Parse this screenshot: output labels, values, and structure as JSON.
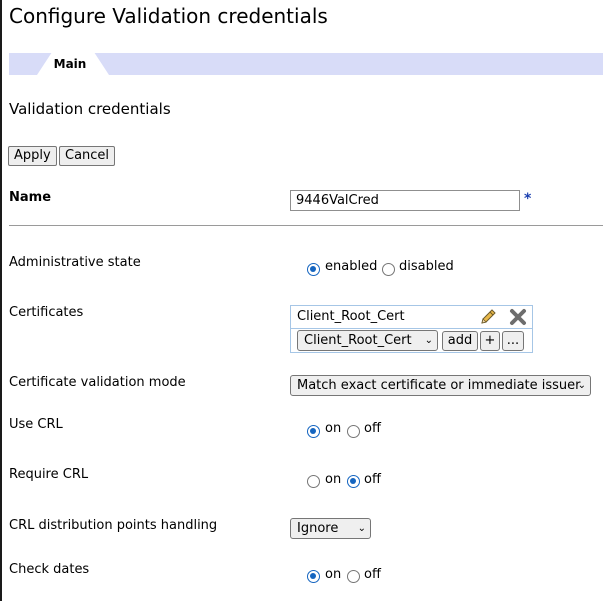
{
  "page": {
    "title": "Configure Validation credentials"
  },
  "tabs": [
    {
      "label": "Main"
    }
  ],
  "section": {
    "title": "Validation credentials"
  },
  "buttons": {
    "apply": "Apply",
    "cancel": "Cancel"
  },
  "fields": {
    "name": {
      "label": "Name",
      "value": "9446ValCred",
      "required_marker": "*"
    },
    "admin_state": {
      "label": "Administrative state",
      "options": [
        "enabled",
        "disabled"
      ],
      "selected": "enabled"
    },
    "certificates": {
      "label": "Certificates",
      "items": [
        "Client_Root_Cert"
      ],
      "select_value": "Client_Root_Cert",
      "add_label": "add",
      "plus_label": "+",
      "more_label": "..."
    },
    "validation_mode": {
      "label": "Certificate validation mode",
      "value": "Match exact certificate or immediate issuer"
    },
    "use_crl": {
      "label": "Use CRL",
      "options": [
        "on",
        "off"
      ],
      "selected": "on"
    },
    "require_crl": {
      "label": "Require CRL",
      "options": [
        "on",
        "off"
      ],
      "selected": "off"
    },
    "crl_dp": {
      "label": "CRL distribution points handling",
      "value": "Ignore"
    },
    "check_dates": {
      "label": "Check dates",
      "options": [
        "on",
        "off"
      ],
      "selected": "on"
    }
  },
  "colors": {
    "tab_bar": "#d8dcf8",
    "accent": "#1565c0",
    "cert_border": "#a6c6e6"
  },
  "icons": {
    "edit": "pencil-icon",
    "delete": "x-delete-icon",
    "dropdown": "chevron-down-icon"
  }
}
